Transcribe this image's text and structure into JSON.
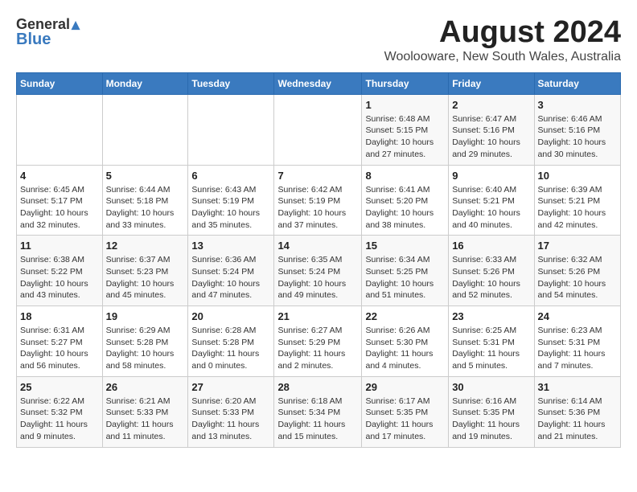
{
  "logo": {
    "general": "General",
    "blue": "Blue"
  },
  "title": {
    "month_year": "August 2024",
    "location": "Woolooware, New South Wales, Australia"
  },
  "headers": [
    "Sunday",
    "Monday",
    "Tuesday",
    "Wednesday",
    "Thursday",
    "Friday",
    "Saturday"
  ],
  "weeks": [
    [
      {
        "day": "",
        "sunrise": "",
        "sunset": "",
        "daylight": ""
      },
      {
        "day": "",
        "sunrise": "",
        "sunset": "",
        "daylight": ""
      },
      {
        "day": "",
        "sunrise": "",
        "sunset": "",
        "daylight": ""
      },
      {
        "day": "",
        "sunrise": "",
        "sunset": "",
        "daylight": ""
      },
      {
        "day": "1",
        "sunrise": "Sunrise: 6:48 AM",
        "sunset": "Sunset: 5:15 PM",
        "daylight": "Daylight: 10 hours and 27 minutes."
      },
      {
        "day": "2",
        "sunrise": "Sunrise: 6:47 AM",
        "sunset": "Sunset: 5:16 PM",
        "daylight": "Daylight: 10 hours and 29 minutes."
      },
      {
        "day": "3",
        "sunrise": "Sunrise: 6:46 AM",
        "sunset": "Sunset: 5:16 PM",
        "daylight": "Daylight: 10 hours and 30 minutes."
      }
    ],
    [
      {
        "day": "4",
        "sunrise": "Sunrise: 6:45 AM",
        "sunset": "Sunset: 5:17 PM",
        "daylight": "Daylight: 10 hours and 32 minutes."
      },
      {
        "day": "5",
        "sunrise": "Sunrise: 6:44 AM",
        "sunset": "Sunset: 5:18 PM",
        "daylight": "Daylight: 10 hours and 33 minutes."
      },
      {
        "day": "6",
        "sunrise": "Sunrise: 6:43 AM",
        "sunset": "Sunset: 5:19 PM",
        "daylight": "Daylight: 10 hours and 35 minutes."
      },
      {
        "day": "7",
        "sunrise": "Sunrise: 6:42 AM",
        "sunset": "Sunset: 5:19 PM",
        "daylight": "Daylight: 10 hours and 37 minutes."
      },
      {
        "day": "8",
        "sunrise": "Sunrise: 6:41 AM",
        "sunset": "Sunset: 5:20 PM",
        "daylight": "Daylight: 10 hours and 38 minutes."
      },
      {
        "day": "9",
        "sunrise": "Sunrise: 6:40 AM",
        "sunset": "Sunset: 5:21 PM",
        "daylight": "Daylight: 10 hours and 40 minutes."
      },
      {
        "day": "10",
        "sunrise": "Sunrise: 6:39 AM",
        "sunset": "Sunset: 5:21 PM",
        "daylight": "Daylight: 10 hours and 42 minutes."
      }
    ],
    [
      {
        "day": "11",
        "sunrise": "Sunrise: 6:38 AM",
        "sunset": "Sunset: 5:22 PM",
        "daylight": "Daylight: 10 hours and 43 minutes."
      },
      {
        "day": "12",
        "sunrise": "Sunrise: 6:37 AM",
        "sunset": "Sunset: 5:23 PM",
        "daylight": "Daylight: 10 hours and 45 minutes."
      },
      {
        "day": "13",
        "sunrise": "Sunrise: 6:36 AM",
        "sunset": "Sunset: 5:24 PM",
        "daylight": "Daylight: 10 hours and 47 minutes."
      },
      {
        "day": "14",
        "sunrise": "Sunrise: 6:35 AM",
        "sunset": "Sunset: 5:24 PM",
        "daylight": "Daylight: 10 hours and 49 minutes."
      },
      {
        "day": "15",
        "sunrise": "Sunrise: 6:34 AM",
        "sunset": "Sunset: 5:25 PM",
        "daylight": "Daylight: 10 hours and 51 minutes."
      },
      {
        "day": "16",
        "sunrise": "Sunrise: 6:33 AM",
        "sunset": "Sunset: 5:26 PM",
        "daylight": "Daylight: 10 hours and 52 minutes."
      },
      {
        "day": "17",
        "sunrise": "Sunrise: 6:32 AM",
        "sunset": "Sunset: 5:26 PM",
        "daylight": "Daylight: 10 hours and 54 minutes."
      }
    ],
    [
      {
        "day": "18",
        "sunrise": "Sunrise: 6:31 AM",
        "sunset": "Sunset: 5:27 PM",
        "daylight": "Daylight: 10 hours and 56 minutes."
      },
      {
        "day": "19",
        "sunrise": "Sunrise: 6:29 AM",
        "sunset": "Sunset: 5:28 PM",
        "daylight": "Daylight: 10 hours and 58 minutes."
      },
      {
        "day": "20",
        "sunrise": "Sunrise: 6:28 AM",
        "sunset": "Sunset: 5:28 PM",
        "daylight": "Daylight: 11 hours and 0 minutes."
      },
      {
        "day": "21",
        "sunrise": "Sunrise: 6:27 AM",
        "sunset": "Sunset: 5:29 PM",
        "daylight": "Daylight: 11 hours and 2 minutes."
      },
      {
        "day": "22",
        "sunrise": "Sunrise: 6:26 AM",
        "sunset": "Sunset: 5:30 PM",
        "daylight": "Daylight: 11 hours and 4 minutes."
      },
      {
        "day": "23",
        "sunrise": "Sunrise: 6:25 AM",
        "sunset": "Sunset: 5:31 PM",
        "daylight": "Daylight: 11 hours and 5 minutes."
      },
      {
        "day": "24",
        "sunrise": "Sunrise: 6:23 AM",
        "sunset": "Sunset: 5:31 PM",
        "daylight": "Daylight: 11 hours and 7 minutes."
      }
    ],
    [
      {
        "day": "25",
        "sunrise": "Sunrise: 6:22 AM",
        "sunset": "Sunset: 5:32 PM",
        "daylight": "Daylight: 11 hours and 9 minutes."
      },
      {
        "day": "26",
        "sunrise": "Sunrise: 6:21 AM",
        "sunset": "Sunset: 5:33 PM",
        "daylight": "Daylight: 11 hours and 11 minutes."
      },
      {
        "day": "27",
        "sunrise": "Sunrise: 6:20 AM",
        "sunset": "Sunset: 5:33 PM",
        "daylight": "Daylight: 11 hours and 13 minutes."
      },
      {
        "day": "28",
        "sunrise": "Sunrise: 6:18 AM",
        "sunset": "Sunset: 5:34 PM",
        "daylight": "Daylight: 11 hours and 15 minutes."
      },
      {
        "day": "29",
        "sunrise": "Sunrise: 6:17 AM",
        "sunset": "Sunset: 5:35 PM",
        "daylight": "Daylight: 11 hours and 17 minutes."
      },
      {
        "day": "30",
        "sunrise": "Sunrise: 6:16 AM",
        "sunset": "Sunset: 5:35 PM",
        "daylight": "Daylight: 11 hours and 19 minutes."
      },
      {
        "day": "31",
        "sunrise": "Sunrise: 6:14 AM",
        "sunset": "Sunset: 5:36 PM",
        "daylight": "Daylight: 11 hours and 21 minutes."
      }
    ]
  ]
}
